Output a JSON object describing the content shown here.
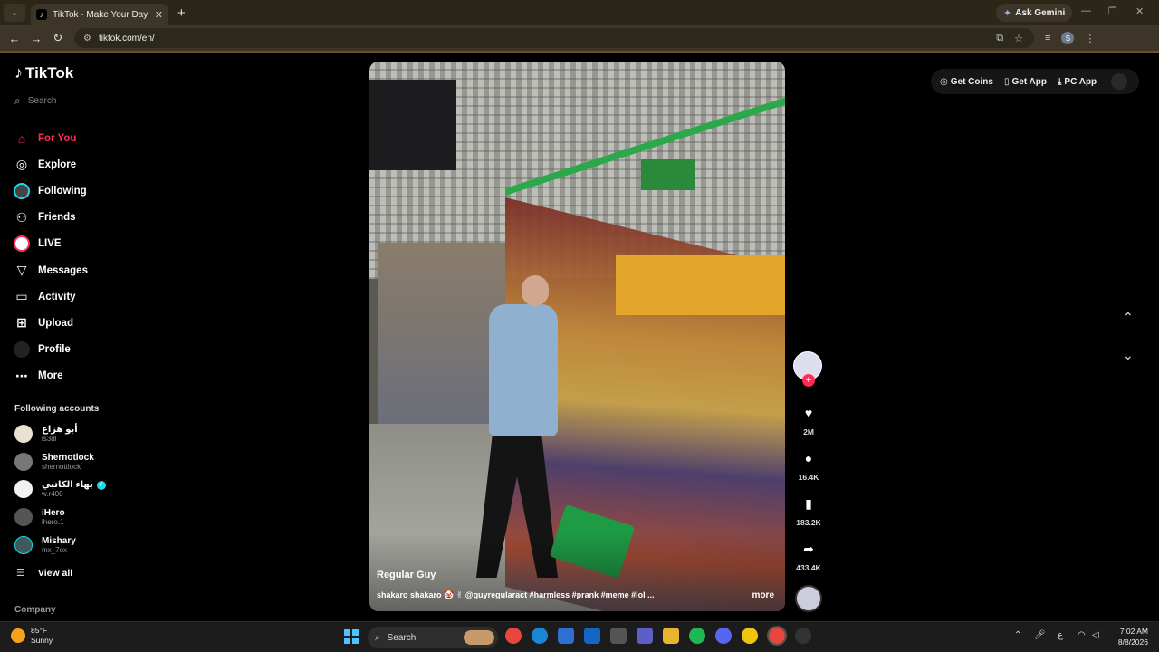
{
  "browser": {
    "tab_title": "TikTok - Make Your Day",
    "url": "tiktok.com/en/",
    "gemini_label": "Ask Gemini",
    "profile_initial": "S"
  },
  "sidebar": {
    "logo": "TikTok",
    "search_placeholder": "Search",
    "nav": [
      {
        "label": "For You",
        "icon": "home-icon"
      },
      {
        "label": "Explore",
        "icon": "compass-icon"
      },
      {
        "label": "Following",
        "icon": "following-avatar-icon"
      },
      {
        "label": "Friends",
        "icon": "friends-icon"
      },
      {
        "label": "LIVE",
        "icon": "live-avatar-icon"
      },
      {
        "label": "Messages",
        "icon": "send-icon"
      },
      {
        "label": "Activity",
        "icon": "message-square-icon"
      },
      {
        "label": "Upload",
        "icon": "plus-square-icon"
      },
      {
        "label": "Profile",
        "icon": "profile-avatar-icon"
      },
      {
        "label": "More",
        "icon": "ellipsis-icon"
      }
    ],
    "following_title": "Following accounts",
    "accounts": [
      {
        "name": "أبو هزاع",
        "handle": "ls3dl",
        "verified": false
      },
      {
        "name": "Shernotlock",
        "handle": "shernottlock",
        "verified": false
      },
      {
        "name": "بهاء الكاتبي",
        "handle": "w.r400",
        "verified": true
      },
      {
        "name": "iHero",
        "handle": "ihero.1",
        "verified": false
      },
      {
        "name": "Mishary",
        "handle": "mx_7ox",
        "verified": false
      }
    ],
    "view_all": "View all",
    "company": "Company"
  },
  "video": {
    "author": "Regular Guy",
    "caption": "shakaro shakaro 🤡 ✌ @guyregularact #harmless #prank #meme #lol ...",
    "more": "more"
  },
  "actions": {
    "likes": "2M",
    "comments": "16.4K",
    "saves": "183.2K",
    "shares": "433.4K"
  },
  "topbar": {
    "get_coins": "Get Coins",
    "get_app": "Get App",
    "pc_app": "PC App"
  },
  "taskbar": {
    "temperature": "85°F",
    "condition": "Sunny",
    "search_label": "Search",
    "language": "ع",
    "time": "7:02 AM",
    "date": "8/8/2026"
  },
  "colors": {
    "accent": "#fe2c55",
    "following_ring": "#20d5ec",
    "browser_frame": "#3d3628"
  }
}
